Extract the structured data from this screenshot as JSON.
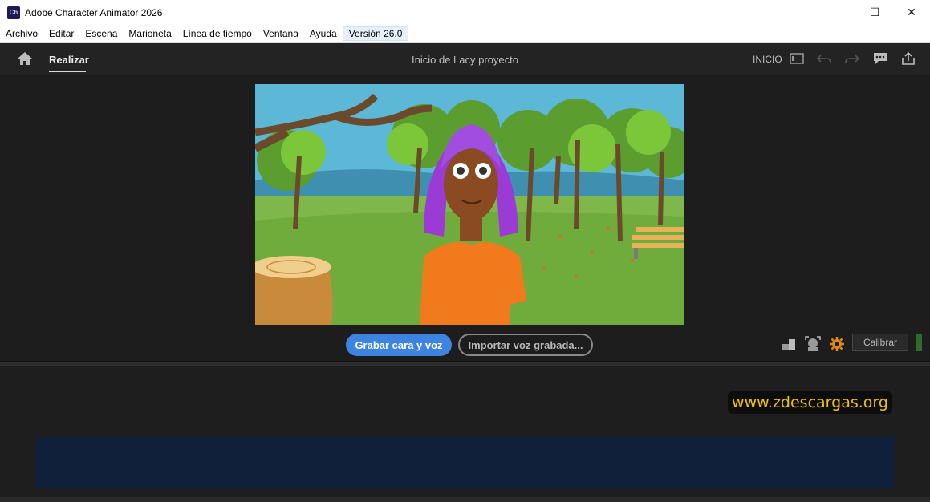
{
  "window": {
    "app_icon_text": "Ch",
    "title": "Adobe Character Animator 2026",
    "minimize": "—",
    "maximize": "☐",
    "close": "✕"
  },
  "menu": {
    "items": [
      "Archivo",
      "Editar",
      "Escena",
      "Marioneta",
      "Línea de tiempo",
      "Ventana",
      "Ayuda",
      "Versión 26.0"
    ]
  },
  "header": {
    "tab_label": "Realizar",
    "project_title": "Inicio de Lacy proyecto",
    "inicio_label": "INICIO",
    "icons": [
      "home-icon",
      "panel-icon",
      "undo-icon",
      "redo-icon",
      "comment-icon",
      "share-icon"
    ]
  },
  "controls": {
    "record_label": "Grabar cara y voz",
    "import_label": "Importar voz grabada...",
    "calibrate_label": "Calibrar",
    "icons": [
      "puppet-track-icon",
      "face-track-icon",
      "settings-icon"
    ]
  },
  "watermark": "www.zdescargas.org",
  "colors": {
    "accent": "#3c84e0",
    "watermark": "#f2c300",
    "timeline": "#10203a"
  }
}
